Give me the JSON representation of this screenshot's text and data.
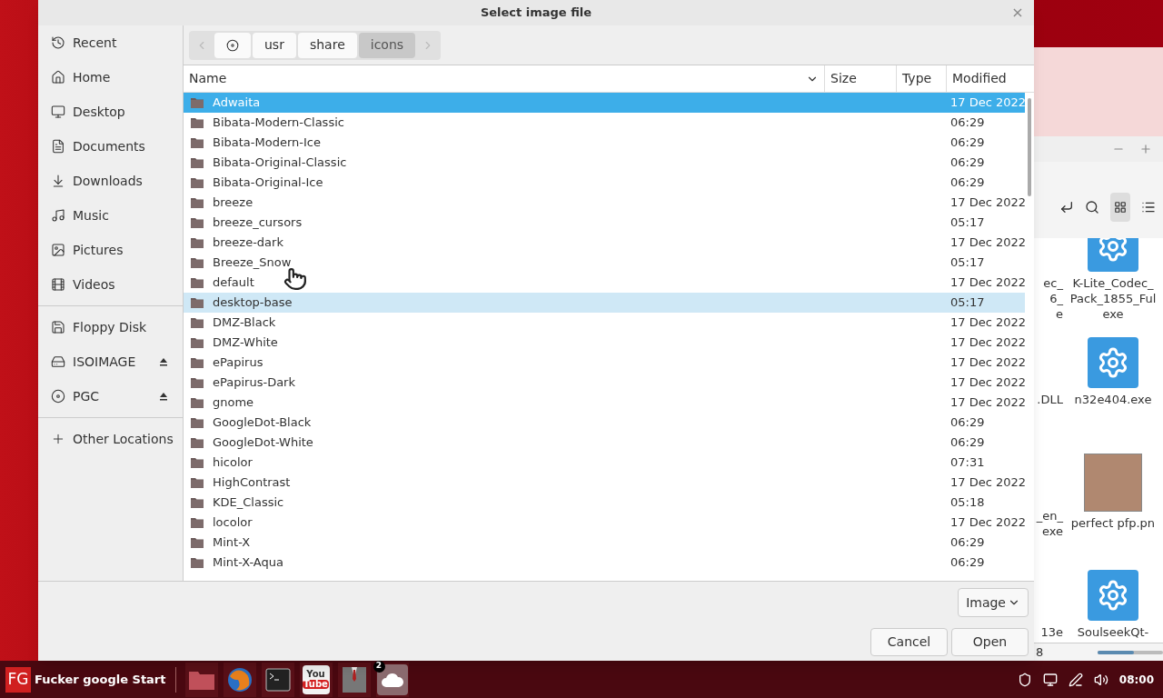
{
  "dialog": {
    "title": "Select image file",
    "close": "×"
  },
  "sidebar": {
    "places": [
      {
        "label": "Recent"
      },
      {
        "label": "Home"
      },
      {
        "label": "Desktop"
      },
      {
        "label": "Documents"
      },
      {
        "label": "Downloads"
      },
      {
        "label": "Music"
      },
      {
        "label": "Pictures"
      },
      {
        "label": "Videos"
      }
    ],
    "devices": [
      {
        "label": "Floppy Disk",
        "eject": false
      },
      {
        "label": "ISOIMAGE",
        "eject": true
      },
      {
        "label": "PGC",
        "eject": true
      }
    ],
    "other": {
      "label": "Other Locations"
    }
  },
  "path_bar": {
    "segments": [
      {
        "kind": "root",
        "selected": false
      },
      {
        "label": "usr",
        "selected": false
      },
      {
        "label": "share",
        "selected": false
      },
      {
        "label": "icons",
        "selected": true
      }
    ]
  },
  "table": {
    "columns": [
      "Name",
      "Size",
      "Type",
      "Modified"
    ],
    "rows": [
      {
        "name": "Adwaita",
        "modified": "17 Dec 2022",
        "selected": true,
        "hover": false
      },
      {
        "name": "Bibata-Modern-Classic",
        "modified": "06:29",
        "selected": false,
        "hover": false
      },
      {
        "name": "Bibata-Modern-Ice",
        "modified": "06:29",
        "selected": false,
        "hover": false
      },
      {
        "name": "Bibata-Original-Classic",
        "modified": "06:29",
        "selected": false,
        "hover": false
      },
      {
        "name": "Bibata-Original-Ice",
        "modified": "06:29",
        "selected": false,
        "hover": false
      },
      {
        "name": "breeze",
        "modified": "17 Dec 2022",
        "selected": false,
        "hover": false
      },
      {
        "name": "breeze_cursors",
        "modified": "05:17",
        "selected": false,
        "hover": false
      },
      {
        "name": "breeze-dark",
        "modified": "17 Dec 2022",
        "selected": false,
        "hover": false
      },
      {
        "name": "Breeze_Snow",
        "modified": "05:17",
        "selected": false,
        "hover": false
      },
      {
        "name": "default",
        "modified": "17 Dec 2022",
        "selected": false,
        "hover": false
      },
      {
        "name": "desktop-base",
        "modified": "05:17",
        "selected": false,
        "hover": true
      },
      {
        "name": "DMZ-Black",
        "modified": "17 Dec 2022",
        "selected": false,
        "hover": false
      },
      {
        "name": "DMZ-White",
        "modified": "17 Dec 2022",
        "selected": false,
        "hover": false
      },
      {
        "name": "ePapirus",
        "modified": "17 Dec 2022",
        "selected": false,
        "hover": false
      },
      {
        "name": "ePapirus-Dark",
        "modified": "17 Dec 2022",
        "selected": false,
        "hover": false
      },
      {
        "name": "gnome",
        "modified": "17 Dec 2022",
        "selected": false,
        "hover": false
      },
      {
        "name": "GoogleDot-Black",
        "modified": "06:29",
        "selected": false,
        "hover": false
      },
      {
        "name": "GoogleDot-White",
        "modified": "06:29",
        "selected": false,
        "hover": false
      },
      {
        "name": "hicolor",
        "modified": "07:31",
        "selected": false,
        "hover": false
      },
      {
        "name": "HighContrast",
        "modified": "17 Dec 2022",
        "selected": false,
        "hover": false
      },
      {
        "name": "KDE_Classic",
        "modified": "05:18",
        "selected": false,
        "hover": false
      },
      {
        "name": "locolor",
        "modified": "17 Dec 2022",
        "selected": false,
        "hover": false
      },
      {
        "name": "Mint-X",
        "modified": "06:29",
        "selected": false,
        "hover": false
      },
      {
        "name": "Mint-X-Aqua",
        "modified": "06:29",
        "selected": false,
        "hover": false
      }
    ]
  },
  "filter": {
    "value": "Image"
  },
  "buttons": [
    "Cancel",
    "Open"
  ],
  "background_window": {
    "left_labels": [
      [
        "ec_",
        "6_",
        "e"
      ],
      [
        ".DLL"
      ],
      [
        "_en_",
        "exe"
      ],
      [
        "13e"
      ]
    ],
    "files": [
      {
        "kind": "app",
        "label": [
          "K-Lite_Codec_",
          "Pack_1855_Ful",
          "exe"
        ]
      },
      {
        "kind": "app",
        "label": [
          "n32e404.exe"
        ]
      },
      {
        "kind": "photo",
        "label": [
          "perfect pfp.pn"
        ]
      },
      {
        "kind": "app",
        "label": [
          "SoulseekQt-"
        ]
      }
    ],
    "status": "8",
    "zoom": {
      "level": 0.55
    }
  },
  "taskbar": {
    "logo": "FG",
    "start": "Fucker google Start",
    "apps": [
      {
        "kind": "folder"
      },
      {
        "kind": "browser"
      },
      {
        "kind": "terminal"
      },
      {
        "kind": "video",
        "label": "You",
        "label2": "Tube"
      },
      {
        "kind": "suit"
      },
      {
        "kind": "cloud",
        "badge": "2"
      }
    ],
    "clock": "08:00"
  }
}
